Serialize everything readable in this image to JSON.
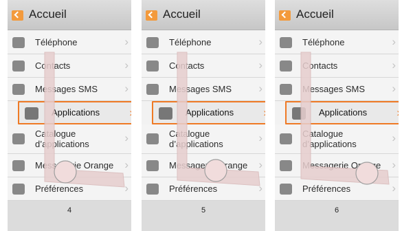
{
  "panels": [
    {
      "title": "Accueil",
      "menu": [
        "Téléphone",
        "Contacts",
        "Messages SMS",
        "Applications",
        "Catalogue\nd’applications",
        "Messagerie Orange",
        "Préférences"
      ],
      "selected_index": 3,
      "step": "4"
    },
    {
      "title": "Accueil",
      "menu": [
        "Téléphone",
        "Contacts",
        "Messages SMS",
        "Applications",
        "Catalogue\nd’applications",
        "Messagerie Orange",
        "Préférences"
      ],
      "selected_index": 3,
      "step": "5"
    },
    {
      "title": "Accueil",
      "menu": [
        "Téléphone",
        "Contacts",
        "Messages SMS",
        "Applications",
        "Catalogue\nd’applications",
        "Messagerie Orange",
        "Préférences"
      ],
      "selected_index": 3,
      "step": "6"
    }
  ],
  "icons": {
    "app": "home-back-icon",
    "item": "app-square-icon",
    "chevron": "chevron-right-icon",
    "gesture": "finger-touch-icon"
  },
  "colors": {
    "accent": "#ef7a25",
    "gesture_fill": "#e7cece",
    "icon": "#f39a3c"
  }
}
